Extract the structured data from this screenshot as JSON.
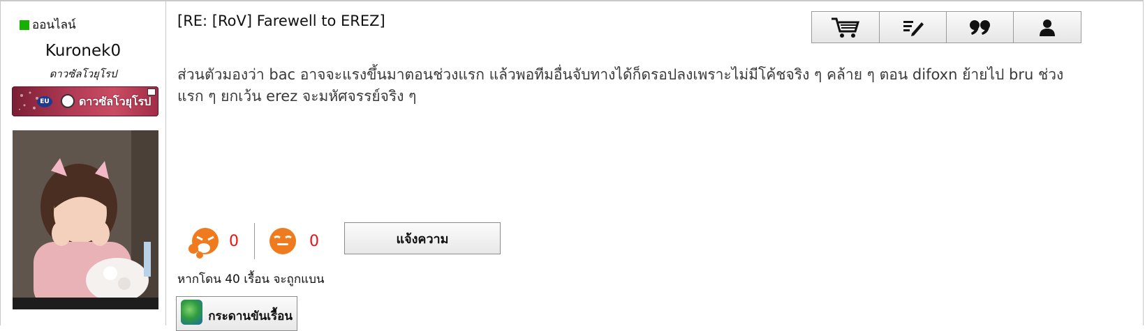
{
  "sidebar": {
    "status_label": "ออนไลน์",
    "username": "Kuronek0",
    "rank_title": "ดาวซัลโวยุโรป",
    "rank_badge_text": "ดาวซัลโวยุโรป",
    "rank_badge_region": "EU"
  },
  "post": {
    "title": "[RE: [RoV] Farewell to EREZ]",
    "body": "ส่วนตัวมองว่า bac อาจจะแรงขึ้นมาตอนช่วงแรก แล้วพอทีมอื่นจับทางได้ก็ดรอปลงเพราะไม่มีโค้ชจริง ๆ คล้าย ๆ ตอน difoxn ย้ายไป bru ช่วงแรก ๆ ยกเว้น erez จะมหัศจรรย์จริง ๆ"
  },
  "toolbar": {
    "icons": [
      "cart-icon",
      "edit-icon",
      "quote-icon",
      "user-icon"
    ]
  },
  "reactions": {
    "like_count": "0",
    "dislike_count": "0"
  },
  "report_button_label": "แจ้งความ",
  "warning_text": "หากโดน 40 เรื้อน จะถูกแบน",
  "bottom_button_label": "กระดานขันเรื้อน",
  "colors": {
    "online": "#17b000",
    "reaction_count": "#e11111",
    "reaction_icon": "#f07a1e"
  }
}
